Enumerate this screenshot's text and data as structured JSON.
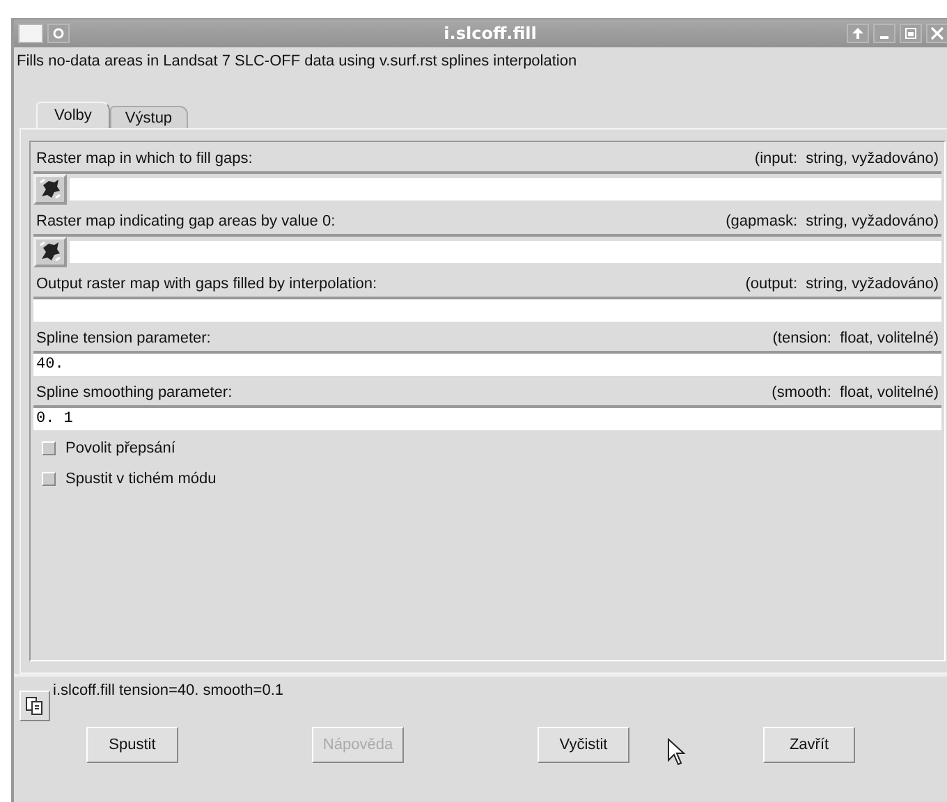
{
  "window": {
    "title": "i.slcoff.fill"
  },
  "description": "Fills no-data areas in Landsat 7 SLC-OFF data using v.surf.rst splines interpolation",
  "tabs": [
    {
      "label": "Volby",
      "selected": true
    },
    {
      "label": "Výstup",
      "selected": false
    }
  ],
  "parameters": [
    {
      "kind": "map",
      "label": "Raster map in which to fill gaps:",
      "info": "(input:  string, vyžadováno)"
    },
    {
      "kind": "map",
      "label": "Raster map indicating gap areas by value 0:",
      "info": "(gapmask:  string, vyžadováno)"
    },
    {
      "kind": "text",
      "label": "Output raster map with gaps filled by interpolation:",
      "info": "(output:  string, vyžadováno)"
    },
    {
      "kind": "text",
      "label": "Spline tension parameter:",
      "info": "(tension:  float, volitelné)",
      "value": "40."
    },
    {
      "kind": "text",
      "label": "Spline smoothing parameter:",
      "info": "(smooth:  float, volitelné)",
      "value": "0. 1"
    }
  ],
  "flags": [
    {
      "label": "Povolit přepsání",
      "checked": false
    },
    {
      "label": "Spustit v tichém módu",
      "checked": false
    }
  ],
  "command": "i.slcoff.fill tension=40. smooth=0.1",
  "buttons": [
    {
      "label": "Spustit",
      "disabled": false
    },
    {
      "label": "Nápověda",
      "disabled": true
    },
    {
      "label": "Vyčistit",
      "disabled": false
    },
    {
      "label": "Zavřít",
      "disabled": false
    }
  ]
}
